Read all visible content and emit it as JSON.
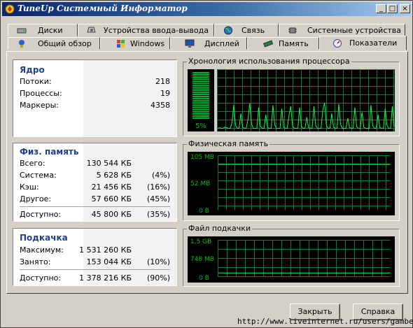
{
  "window": {
    "title": "TuneUp Системный Информатор",
    "minimize_glyph": "_",
    "maximize_glyph": "□",
    "close_glyph": "×"
  },
  "tabs_back": [
    {
      "label": "Диски",
      "icon": "disk-icon"
    },
    {
      "label": "Устройства ввода-вывода",
      "icon": "io-devices-icon"
    },
    {
      "label": "Связь",
      "icon": "globe-icon"
    },
    {
      "label": "Системные устройства",
      "icon": "chip-icon"
    }
  ],
  "tabs_front": [
    {
      "label": "Общий обзор",
      "icon": "overview-icon"
    },
    {
      "label": "Windows",
      "icon": "windows-logo-icon"
    },
    {
      "label": "Дисплей",
      "icon": "display-icon"
    },
    {
      "label": "Память",
      "icon": "memory-icon"
    },
    {
      "label": "Показатели",
      "icon": "performance-icon",
      "active": true
    }
  ],
  "kernel": {
    "title": "Ядро",
    "rows": [
      {
        "label": "Потоки:",
        "value": "218"
      },
      {
        "label": "Процессы:",
        "value": "19"
      },
      {
        "label": "Маркеры:",
        "value": "4358"
      }
    ]
  },
  "physical": {
    "title": "Физ. память",
    "rows": [
      {
        "label": "Всего:",
        "value": "130 544 КБ",
        "pct": ""
      },
      {
        "label": "Система:",
        "value": "5 628 КБ",
        "pct": "(4%)"
      },
      {
        "label": "Кэш:",
        "value": "21 456 КБ",
        "pct": "(16%)"
      },
      {
        "label": "Другое:",
        "value": "57 660 КБ",
        "pct": "(45%)"
      }
    ],
    "available": {
      "label": "Доступно:",
      "value": "45 800 КБ",
      "pct": "(35%)"
    }
  },
  "paging": {
    "title": "Подкачка",
    "rows": [
      {
        "label": "Максимум:",
        "value": "1 531 260 КБ",
        "pct": ""
      },
      {
        "label": "Занято:",
        "value": "153 044 КБ",
        "pct": "(10%)"
      }
    ],
    "available": {
      "label": "Доступно:",
      "value": "1 378 216 КБ",
      "pct": "(90%)"
    }
  },
  "cpu": {
    "group_title": "Хронология использования процессора",
    "percent_label": "5%",
    "level": 0.05,
    "history": [
      3,
      4,
      3,
      3,
      5,
      4,
      3,
      3,
      12,
      42,
      8,
      3,
      3,
      28,
      5,
      3,
      3,
      18,
      45,
      10,
      3,
      3,
      3,
      38,
      6,
      3,
      3,
      26,
      4,
      3,
      3,
      42,
      9,
      3,
      3,
      3,
      36,
      5,
      3,
      3,
      24,
      40,
      7,
      3,
      3,
      3,
      38,
      6,
      3,
      3,
      22,
      4,
      3,
      3,
      40,
      8,
      3,
      3,
      3,
      34,
      46,
      8,
      3,
      3,
      28,
      5,
      3,
      3,
      44,
      9,
      3,
      3,
      3,
      20,
      4,
      3,
      3,
      38,
      6,
      3,
      3,
      30,
      5,
      3,
      3,
      3,
      42,
      7,
      3,
      3,
      26,
      4,
      3,
      3,
      36,
      8,
      3,
      3,
      40,
      6
    ]
  },
  "physmem": {
    "group_title": "Физическая память",
    "axis": [
      "105 MB",
      "52 MB",
      "0 B"
    ],
    "max": 105,
    "current": 88
  },
  "pagefile": {
    "group_title": "Файл подкачки",
    "axis": [
      "1,5 GB",
      "748 MB",
      "0 B"
    ],
    "max": 1.5,
    "current": 0.15
  },
  "buttons": {
    "close": "Закрыть",
    "help": "Справка"
  },
  "footer_url": "http://www.liveinternet.ru/users/gambert/",
  "colors": {
    "trace": "#00ff40",
    "grid": "#008040",
    "heading": "#1f3f8f"
  }
}
